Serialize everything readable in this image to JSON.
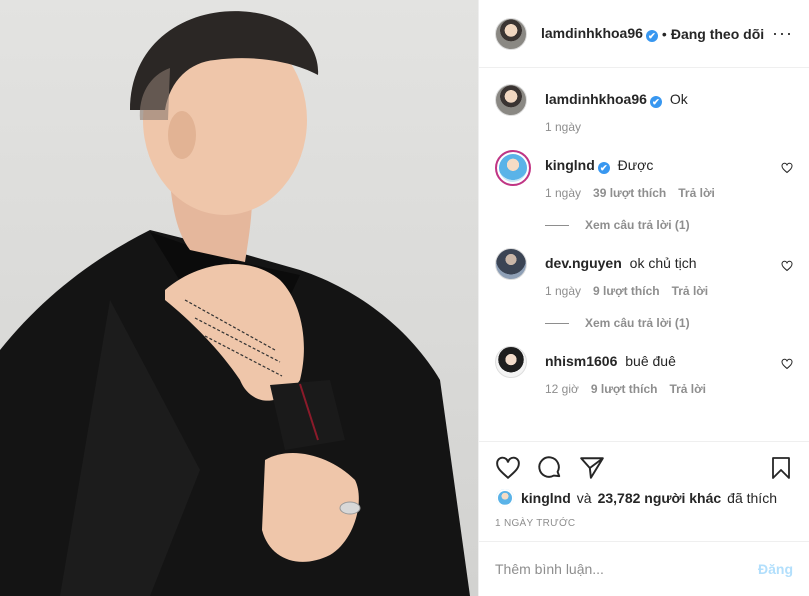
{
  "header": {
    "username": "lamdinhkhoa96",
    "verified_mark": "✔",
    "separator": "•",
    "follow_status": "Đang theo dõi",
    "more_label": "···"
  },
  "comments": [
    {
      "username": "lamdinhkhoa96",
      "verified": true,
      "text": "Ok",
      "time": "1 ngày",
      "likes": "",
      "reply": "",
      "view_replies": "",
      "avatar": "avatar-lamdinhkhoa96"
    },
    {
      "username": "kinglnd",
      "verified": true,
      "text": "Được",
      "time": "1 ngày",
      "likes": "39 lượt thích",
      "reply": "Trả lời",
      "view_replies": "Xem câu trả lời (1)",
      "avatar": "avatar-kinglnd"
    },
    {
      "username": "dev.nguyen",
      "verified": false,
      "text": "ok chủ tịch",
      "time": "1 ngày",
      "likes": "9 lượt thích",
      "reply": "Trả lời",
      "view_replies": "Xem câu trả lời (1)",
      "avatar": "avatar-dev-nguyen"
    },
    {
      "username": "nhism1606",
      "verified": false,
      "text": "buê đuê",
      "time": "12 giờ",
      "likes": "9 lượt thích",
      "reply": "Trả lời",
      "view_replies": "",
      "avatar": "avatar-nhism1606"
    }
  ],
  "actions": {
    "like_icon": "heart-icon",
    "comment_icon": "comment-bubble-icon",
    "share_icon": "paper-plane-icon",
    "save_icon": "bookmark-icon"
  },
  "likes": {
    "user": "kinglnd",
    "and": "và",
    "others": "23,782 người khác",
    "suffix": "đã thích"
  },
  "post_date": "1 NGÀY TRƯỚC",
  "add_comment": {
    "placeholder": "Thêm bình luận...",
    "post_label": "Đăng"
  },
  "colors": {
    "accent": "#3897f0",
    "muted": "#8e8e8e",
    "text": "#262626",
    "post_disabled": "#b2dffc",
    "border": "#efefef"
  }
}
